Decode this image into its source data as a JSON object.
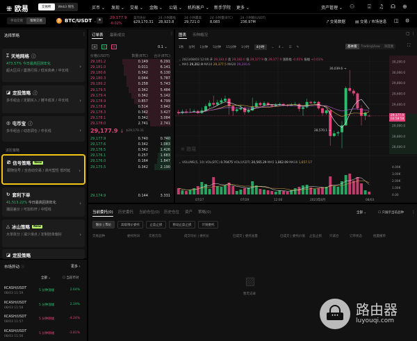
{
  "topnav": {
    "logo": "欧易",
    "toggle": [
      "交易所",
      "Web3 钱包"
    ],
    "menu": [
      "买币",
      "发现",
      "交易",
      "金融",
      "公链",
      "机构客户",
      "新手学院",
      "更多"
    ],
    "asset_mgmt": "资产管理"
  },
  "subbar": {
    "mode": [
      "手动交易",
      "策略交易"
    ],
    "pair": "BTC/USDT",
    "last_price": "29,177.9",
    "change": "-0.02%",
    "stats": [
      {
        "label": "美元估价",
        "value": "$29,170.31"
      },
      {
        "label": "24 小时最低",
        "value": "28,923.8"
      },
      {
        "label": "24 小时最高",
        "value": "29,721.0"
      },
      {
        "label": "24 小时量(BTC)",
        "value": "8,083"
      },
      {
        "label": "24 小时额(USDT)",
        "value": "236.97M"
      }
    ],
    "trade_data": "交易数据",
    "market_info": "交易 / 市场信息"
  },
  "strategy": {
    "title": "选择策略",
    "cards": [
      {
        "name": "天地网格",
        "perf": "473.57%",
        "perf_label": "今日最高回测年化",
        "desc": "超大区间 / 震荡行情 / 低买高卖 / 中长线"
      },
      {
        "name": "定投策略",
        "desc": "多币组合 / 定期买入 / 摊平成本 / 中长线"
      },
      {
        "name": "屯币宝",
        "desc": "多币组合 / 动态调仓 / 中长线"
      },
      {
        "name": "信号策略",
        "badge": "New",
        "desc": "跟随信号 / 全自动交易 / 高可塑性 低时延"
      },
      {
        "name": "套利下单",
        "perf": "41,513.22%",
        "perf_label": "今日最高回测年化",
        "desc": "捕捉差价 / 可加杠杆 / 中短线"
      },
      {
        "name": "冰山策略",
        "badge": "New",
        "desc": "大单拆分 / 减少滑点 / 定制挂单偏好"
      },
      {
        "name": "定投策略"
      }
    ],
    "advanced_label": "进阶策略"
  },
  "market": {
    "title": "市场异动",
    "more": "更多",
    "filter": "全部",
    "current_pair": "当前币对",
    "rows": [
      {
        "pair": "KCASH/USDT",
        "time": "08/03 11:59",
        "type": "5 分钟涨幅",
        "value": "2.64%",
        "up": true
      },
      {
        "pair": "KCASH/USDT",
        "time": "08/03 11:58",
        "type": "5 分钟涨幅",
        "value": "2.19%",
        "up": true
      },
      {
        "pair": "KCASH/USDT",
        "time": "08/03 11:57",
        "type": "5 分钟跌幅",
        "value": "-4.24%",
        "up": false
      },
      {
        "pair": "KCASH/USDT",
        "time": "08/03 11:56",
        "type": "5 分钟跌幅",
        "value": "-3.81%",
        "up": false
      }
    ]
  },
  "orderbook": {
    "tabs": [
      "订单表",
      "最新成交"
    ],
    "precision": "0.1",
    "headers": [
      "价格(USDT)",
      "数量(BTC)",
      "合计(BTC)"
    ],
    "asks": [
      [
        "29,181.2",
        "0.149",
        "6.291"
      ],
      [
        "29,181.0",
        "0.011",
        "6.141"
      ],
      [
        "29,180.6",
        "0.342",
        "6.130"
      ],
      [
        "29,180.3",
        "0.044",
        "5.787"
      ],
      [
        "29,180.2",
        "0.258",
        "5.743"
      ],
      [
        "29,179.5",
        "0.342",
        "5.484"
      ],
      [
        "29,179.4",
        "0.342",
        "5.142"
      ],
      [
        "29,178.9",
        "0.857",
        "4.799"
      ],
      [
        "29,178.8",
        "0.514",
        "3.942"
      ],
      [
        "29,178.3",
        "0.342",
        "3.427"
      ],
      [
        "29,178.1",
        "0.342",
        "3.084"
      ],
      [
        "29,178.0",
        "2.741",
        "2.741"
      ]
    ],
    "mid_price": "29,177.9",
    "mid_arrow": "↓",
    "mid_usd": "$29,170.31",
    "bids": [
      [
        "29,177.9",
        "0.740",
        "0.740"
      ],
      [
        "29,177.6",
        "0.342",
        "1.083"
      ],
      [
        "29,176.5",
        "0.342",
        "1.426"
      ],
      [
        "29,176.1",
        "0.257",
        "1.683"
      ],
      [
        "29,176.0",
        "0.164",
        "1.847"
      ],
      [
        "29,175.5",
        "0.342",
        "2.190"
      ]
    ],
    "last_bid": [
      "29,174.9",
      "0.144",
      "3.331"
    ]
  },
  "chart": {
    "tabs": [
      "图表",
      "币种概况"
    ],
    "intervals": [
      "1秒",
      "分时",
      "1分钟",
      "5分钟",
      "15分钟",
      "1小时",
      "4小时"
    ],
    "versions": [
      "基本版",
      "TradingView",
      "深度图"
    ],
    "ohlc_line": {
      "date": "2023/08/03 12:00",
      "open_label": "开",
      "open": "29,181.0",
      "high_label": "高",
      "high": "29,182.0",
      "low_label": "低",
      "low": "29,177.9",
      "close_label": "收",
      "close": "29,177.9",
      "amp_label": "涨跌幅",
      "amp": "-0.01%",
      "range_label": "振幅",
      "range": "+0.01%"
    },
    "ma_line": {
      "ma5_label": "MA5",
      "ma5": "29,202.9",
      "ma10_label": "MA10",
      "ma10": "29,377.5",
      "ma20_label": "MA20",
      "ma20": "29,260.6"
    },
    "vol_line": {
      "label": "VOLUME(5, 10)",
      "vb_label": "VOL(BTC)",
      "vb": "0.70475",
      "vu_label": "VOL(USDT)",
      "vu": "20,565.29",
      "ma5_label": "MA5",
      "ma5": "1,862.09",
      "ma10_label": "MA10",
      "ma10": "1,657.17"
    },
    "price_tag": "29,177.9",
    "countdown": "03:58:58",
    "high_mark": "30,039.6",
    "low_mark": "28,570.1",
    "watermark": "欧易"
  },
  "chart_data": {
    "type": "candlestick",
    "price_axis": [
      "30,200.0",
      "30,000.0",
      "29,800.0",
      "29,600.0",
      "29,400.0",
      "29,000.0",
      "28,800.0",
      "28,600.0"
    ],
    "price_range": [
      28550,
      30220
    ],
    "vol_axis": [
      "4.00K",
      "3.00K",
      "2.00K",
      "1.00K",
      "0.00"
    ],
    "vol_range": [
      0,
      4000
    ],
    "x_labels": [
      "07/27",
      "07/29",
      "12:00",
      "2023年8月",
      "08/03"
    ],
    "candles": [
      [
        29250,
        29230,
        29290,
        29200
      ],
      [
        29230,
        29260,
        29300,
        29210
      ],
      [
        29260,
        29240,
        29310,
        29220
      ],
      [
        29240,
        29250,
        29320,
        29230
      ],
      [
        29250,
        29270,
        29300,
        29240
      ],
      [
        29270,
        29230,
        29290,
        29210
      ],
      [
        29230,
        29280,
        29330,
        29220
      ],
      [
        29280,
        29360,
        29400,
        29260
      ],
      [
        29360,
        29420,
        29470,
        29330
      ],
      [
        29420,
        29390,
        29560,
        29350
      ],
      [
        29390,
        29430,
        29480,
        29370
      ],
      [
        29430,
        29470,
        29510,
        29400
      ],
      [
        29460,
        29500,
        29560,
        29430
      ],
      [
        29500,
        29360,
        29520,
        29200
      ],
      [
        29360,
        29270,
        29390,
        29180
      ],
      [
        29270,
        29300,
        29350,
        29240
      ],
      [
        29300,
        29330,
        29380,
        29280
      ],
      [
        29330,
        29250,
        29350,
        29200
      ],
      [
        29250,
        29280,
        29320,
        29230
      ],
      [
        29280,
        29350,
        29520,
        29270
      ],
      [
        29350,
        29420,
        29460,
        29320
      ],
      [
        29420,
        29380,
        29440,
        29350
      ],
      [
        29380,
        29420,
        29450,
        29360
      ],
      [
        29420,
        29380,
        29440,
        29360
      ],
      [
        29380,
        29360,
        29400,
        29340
      ],
      [
        29360,
        29390,
        29420,
        29350
      ],
      [
        29390,
        29400,
        29430,
        29370
      ],
      [
        29400,
        29380,
        29420,
        29360
      ],
      [
        29380,
        29370,
        29400,
        29350
      ],
      [
        29370,
        29390,
        29420,
        29360
      ],
      [
        29390,
        29400,
        29440,
        29370
      ],
      [
        29400,
        29310,
        29420,
        29260
      ],
      [
        29310,
        29340,
        29360,
        29180
      ],
      [
        29340,
        29440,
        29500,
        29320
      ],
      [
        29440,
        29420,
        29460,
        29400
      ],
      [
        29420,
        29440,
        29460,
        29400
      ],
      [
        29440,
        29320,
        29460,
        29290
      ],
      [
        29320,
        29230,
        29340,
        29180
      ],
      [
        29230,
        29280,
        29300,
        29200
      ],
      [
        29280,
        28800,
        29300,
        28620
      ],
      [
        28800,
        28850,
        28900,
        28780
      ],
      [
        28850,
        28870,
        28900,
        28800
      ],
      [
        28870,
        29000,
        29080,
        28570
      ],
      [
        29000,
        29700,
        29730,
        28990
      ],
      [
        29700,
        29650,
        30039,
        29620
      ],
      [
        29650,
        29600,
        29680,
        29560
      ],
      [
        29600,
        29320,
        29620,
        29290
      ],
      [
        29320,
        29180,
        29380,
        29000
      ],
      [
        29180,
        29240,
        29260,
        29100
      ],
      [
        29181,
        29178,
        29200,
        29170
      ]
    ],
    "volumes": [
      900,
      600,
      500,
      700,
      900,
      1200,
      1800,
      1500,
      800,
      2500,
      1200,
      1100,
      1300,
      1700,
      1200,
      500,
      700,
      900,
      1000,
      1900,
      1300,
      800,
      700,
      600,
      500,
      400,
      600,
      500,
      400,
      600,
      900,
      1100,
      1300,
      1400,
      1000,
      800,
      900,
      1000,
      1100,
      2600,
      1200,
      1100,
      1900,
      2800,
      3000,
      2000,
      2500,
      1600,
      600,
      400
    ]
  },
  "orders": {
    "tabs": [
      "当前委托(0)",
      "历史委托",
      "当前仓位(0)",
      "历史仓位",
      "资产",
      "策略(0)"
    ],
    "buttons": [
      "限价 | 市价",
      "高级限价委托",
      "止盈止损",
      "移动止盈止损",
      "计划委托"
    ],
    "filter": "全部",
    "only_current": "只展示当前品种",
    "columns": [
      "交易品种",
      "委托时间",
      "交易方向",
      "成交均价 | 委托价",
      "已成交 | 委托总量",
      "已成交 | 委托价值",
      "止盈止损",
      "只减仓",
      "订单状态",
      "批量撤单"
    ],
    "empty": "暂无记录"
  },
  "watermark": {
    "cn": "路由器",
    "url": "luyouqi.com"
  },
  "colors": {
    "up": "#2dbd6e",
    "down": "#e0457b",
    "highlight": "#f5c518",
    "new_badge": "#b7f36b"
  }
}
